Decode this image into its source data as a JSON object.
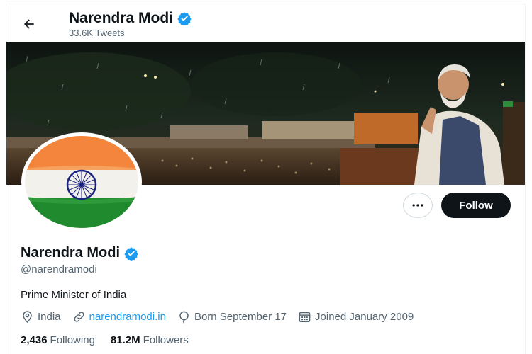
{
  "header": {
    "name": "Narendra Modi",
    "tweet_count": "33.6K Tweets"
  },
  "profile": {
    "name": "Narendra Modi",
    "handle": "@narendramodi",
    "bio": "Prime Minister of India",
    "location": "India",
    "website": "narendramodi.in",
    "birthday": "Born September 17",
    "joined": "Joined January 2009",
    "following_count": "2,436",
    "following_label": "Following",
    "followers_count": "81.2M",
    "followers_label": "Followers"
  },
  "actions": {
    "follow_label": "Follow"
  },
  "icons": {
    "back": "arrow-left-icon",
    "verified": "verified-badge-icon",
    "more": "more-dots-icon",
    "location": "location-pin-icon",
    "link": "link-icon",
    "birthday": "balloon-icon",
    "calendar": "calendar-icon"
  },
  "colors": {
    "accent": "#1d9bf0",
    "text": "#0f1419",
    "muted": "#536471",
    "follow_bg": "#0f1419",
    "saffron": "#f4853c",
    "india_green": "#138808",
    "chakra_blue": "#1a237e"
  }
}
